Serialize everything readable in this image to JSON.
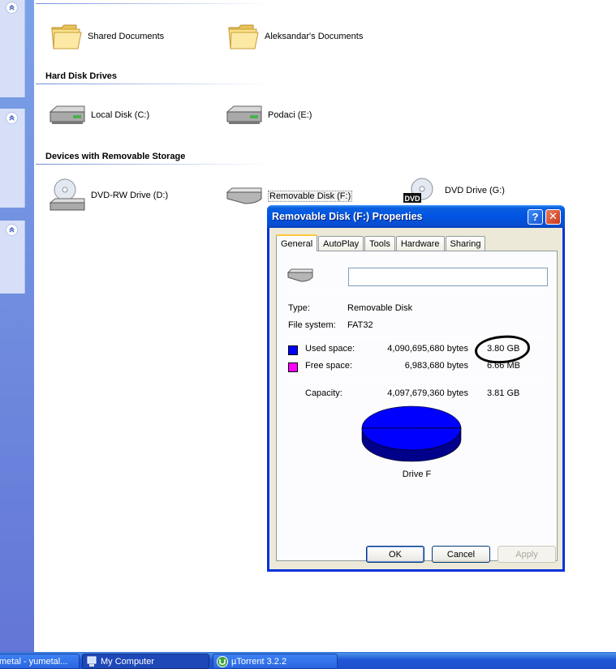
{
  "explorer": {
    "groups": [
      {
        "title": "",
        "items": [
          "Shared Documents",
          "Aleksandar's Documents"
        ]
      },
      {
        "title": "Hard Disk Drives",
        "items": [
          "Local Disk (C:)",
          "Podaci (E:)"
        ]
      },
      {
        "title": "Devices with Removable Storage",
        "items": [
          "DVD-RW Drive (D:)",
          "Removable Disk (F:)",
          "DVD Drive (G:)"
        ]
      }
    ],
    "dvd_badge": "DVD"
  },
  "dialog": {
    "title": "Removable Disk (F:) Properties",
    "help_glyph": "?",
    "close_glyph": "✕",
    "tabs": [
      "General",
      "AutoPlay",
      "Tools",
      "Hardware",
      "Sharing"
    ],
    "name_value": "",
    "type_label": "Type:",
    "type_value": "Removable Disk",
    "fs_label": "File system:",
    "fs_value": "FAT32",
    "used_label": "Used space:",
    "used_bytes": "4,090,695,680 bytes",
    "used_size": "3.80 GB",
    "free_label": "Free space:",
    "free_bytes": "6,983,680 bytes",
    "free_size": "6.66 MB",
    "capacity_label": "Capacity:",
    "capacity_bytes": "4,097,679,360 bytes",
    "capacity_size": "3.81 GB",
    "drive_label": "Drive F",
    "ok": "OK",
    "cancel": "Cancel",
    "apply": "Apply",
    "colors": {
      "used": "#0000ff",
      "free": "#ff00ff"
    }
  },
  "chart_data": {
    "type": "pie",
    "title": "Drive F",
    "categories": [
      "Used space",
      "Free space"
    ],
    "values": [
      4090695680,
      6983680
    ]
  },
  "taskbar": {
    "items": [
      "metal - yumetal...",
      "My Computer",
      "µTorrent 3.2.2"
    ]
  }
}
